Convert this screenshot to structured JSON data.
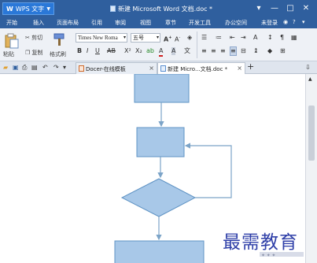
{
  "app": {
    "logo_label": "WPS 文字",
    "doc_title": "新建 Microsoft Word 文档.doc *"
  },
  "window": {
    "minimize": "—",
    "restore": "□",
    "close": "✕"
  },
  "menu": {
    "items": [
      "开始",
      "插入",
      "页面布局",
      "引用",
      "审阅",
      "视图",
      "章节",
      "开发工具",
      "办公空间"
    ],
    "right_label": "未登录"
  },
  "ribbon": {
    "paste_label": "粘贴",
    "cut_label": "剪切",
    "copy_label": "复制",
    "format_painter_label": "格式刷",
    "font_name": "Times New Roma",
    "font_size": "五号"
  },
  "tabs": [
    {
      "label": "Docer-在线模板"
    },
    {
      "label": "新建 Micro...文档.doc *"
    }
  ],
  "watermark": {
    "text": "最需教育"
  },
  "colors": {
    "titlebar": "#2f5f9e",
    "shape_fill": "#a8c8e8",
    "shape_stroke": "#5f93c4",
    "connector": "#7ca4c8",
    "watermark": "#2f3fa8"
  }
}
